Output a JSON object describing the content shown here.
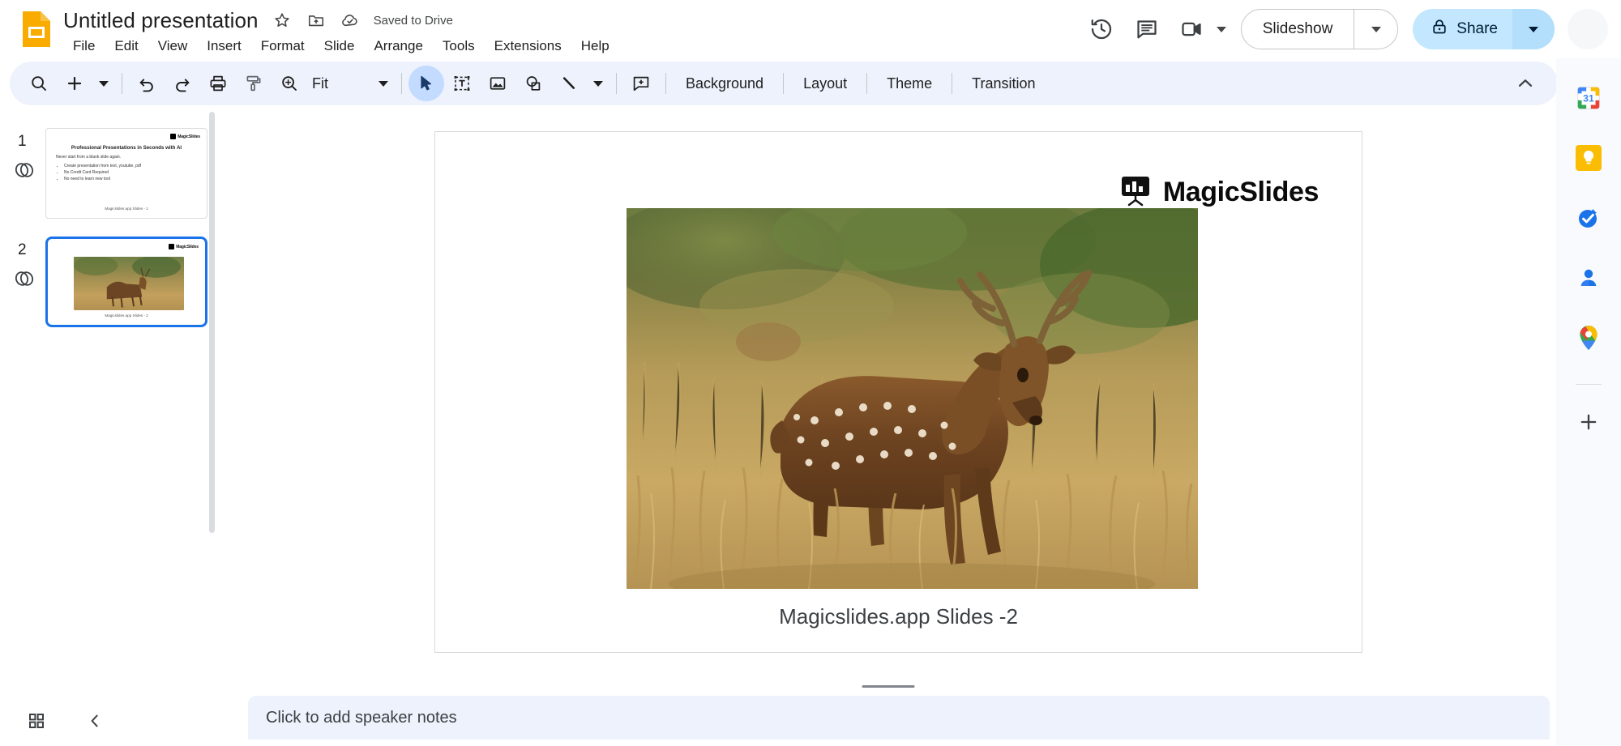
{
  "app": {
    "name": "Google Slides",
    "document_title": "Untitled presentation",
    "save_status": "Saved to Drive"
  },
  "header": {
    "icons": {
      "logo": "slides-logo-icon",
      "star": "star-icon",
      "move_to_folder": "move-to-folder-icon",
      "cloud_saved": "cloud-check-icon",
      "history": "version-history-icon",
      "comments": "comment-icon",
      "meet": "video-camera-icon",
      "meet_caret": "chevron-down-icon"
    },
    "menus": [
      "File",
      "Edit",
      "View",
      "Insert",
      "Format",
      "Slide",
      "Arrange",
      "Tools",
      "Extensions",
      "Help"
    ],
    "slideshow_label": "Slideshow",
    "share_label": "Share",
    "share_lock_icon": "lock-icon"
  },
  "toolbar": {
    "zoom_level_label": "Fit",
    "icons": [
      "search-icon",
      "plus-icon",
      "chevron-down-icon",
      "undo-icon",
      "redo-icon",
      "print-icon",
      "paint-format-icon",
      "zoom-icon",
      "select-cursor-icon",
      "text-box-icon",
      "insert-image-icon",
      "shape-icon",
      "line-icon",
      "chevron-down-icon",
      "add-comment-icon",
      "chevron-up-icon"
    ],
    "text_buttons": [
      "Background",
      "Layout",
      "Theme",
      "Transition"
    ]
  },
  "filmstrip": {
    "slides": [
      {
        "number": "1",
        "selected": false,
        "layers_icon": "layers-icon",
        "content": {
          "brand": "MagicSlides",
          "title": "Professional Presentations in Seconds with AI",
          "subtitle": "Never start from a blank slide again.",
          "bullets": [
            "Create presentation from text, youtube, pdf",
            "No Credit Card Required",
            "No need to learn new tool"
          ],
          "footer": "Magicslides.app Slides - 1"
        }
      },
      {
        "number": "2",
        "selected": true,
        "layers_icon": "layers-icon",
        "content": {
          "brand": "MagicSlides",
          "image_alt": "spotted-deer-photo",
          "footer": "Magicslides.app Slides - 2"
        }
      }
    ]
  },
  "canvas": {
    "current_slide": {
      "brand": "MagicSlides",
      "brand_icon": "easel-chart-icon",
      "image_alt": "spotted-deer-in-grassland-photo",
      "caption": "Magicslides.app Slides -2"
    }
  },
  "notes": {
    "placeholder": "Click to add speaker notes"
  },
  "bottom_bar": {
    "grid_view_icon": "grid-view-icon",
    "collapse_filmstrip_icon": "chevron-left-icon",
    "expand_panel_icon": "chevron-right-icon"
  },
  "side_panel": {
    "items": [
      {
        "name": "google-calendar",
        "icon": "calendar-icon",
        "badge": "31"
      },
      {
        "name": "google-keep",
        "icon": "keep-bulb-icon"
      },
      {
        "name": "google-tasks",
        "icon": "tasks-check-icon"
      },
      {
        "name": "google-contacts",
        "icon": "contacts-person-icon"
      },
      {
        "name": "google-maps",
        "icon": "maps-pin-icon"
      },
      {
        "name": "get-addons",
        "icon": "plus-icon"
      }
    ]
  },
  "colors": {
    "slides_yellow": "#F9AB00",
    "toolbar_bg": "#edf2fc",
    "share_bg": "#c2e7ff",
    "selected_border": "#1a73e8",
    "active_tool_bg": "#c2dbff"
  }
}
